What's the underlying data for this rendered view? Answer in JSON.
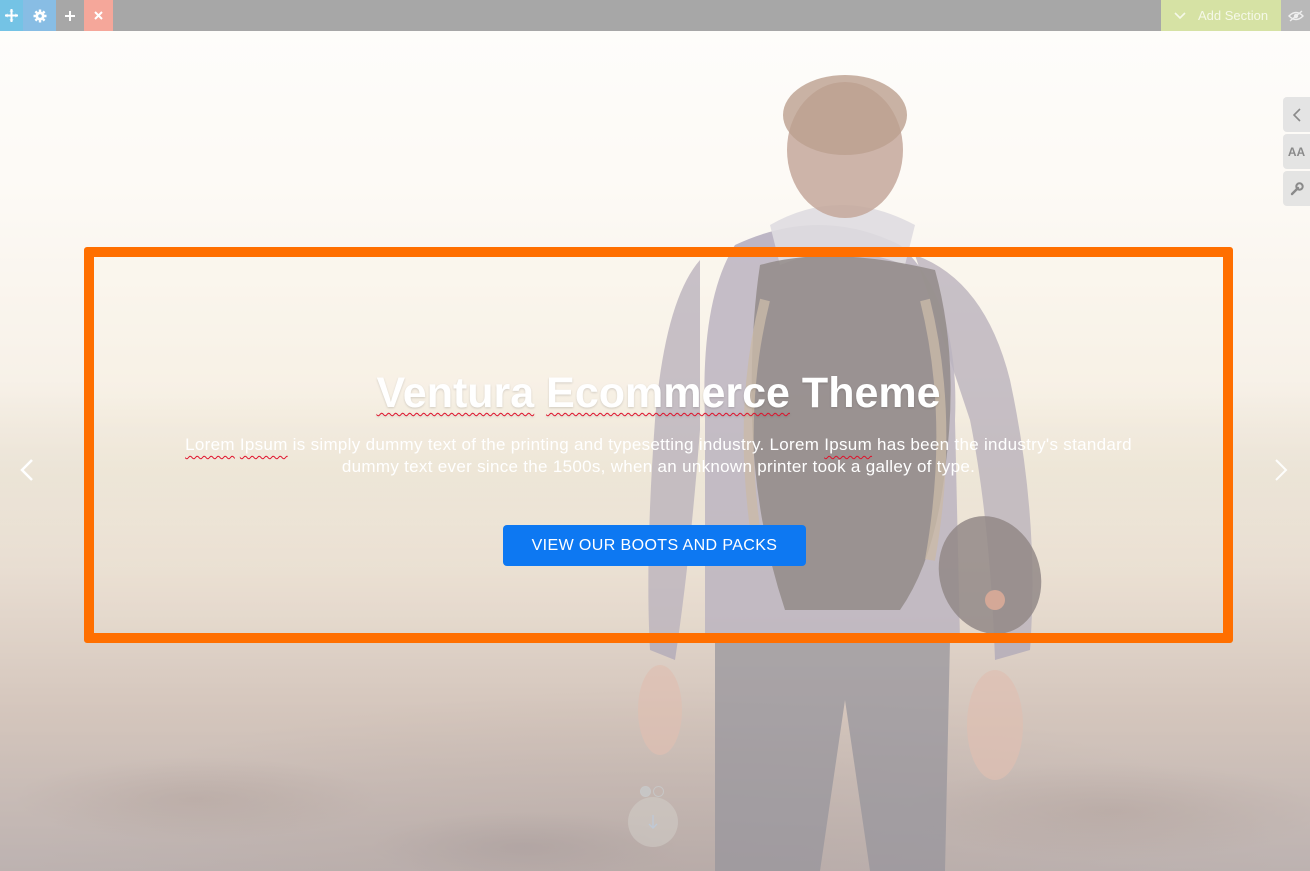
{
  "toolbar": {
    "move_icon": "move-icon",
    "settings_icon": "gear-icon",
    "add_icon": "plus-icon",
    "close_icon": "close-icon",
    "add_section_label": "Add Section",
    "add_section_icon": "chevron-down-icon",
    "visibility_icon": "eye-off-icon"
  },
  "side_tools": {
    "collapse_icon": "chevron-left-icon",
    "typography_label": "AA",
    "typography_icon": "font-size-icon",
    "tools_icon": "wrench-icon"
  },
  "hero": {
    "title_words": [
      "Ventura",
      "Ecommerce",
      "Theme"
    ],
    "description_line1_start": "Lorem",
    "description_line1_flag": "Ipsum",
    "description_line1_mid": " is simply dummy text of the printing and typesetting industry. Lorem ",
    "description_line1_flag2": "Ipsum",
    "description_line1_end": " has been the industry's standard",
    "description_line2": "dummy text ever since the 1500s, when an unknown printer took a galley of type.",
    "button_label": "VIEW OUR BOOTS AND PACKS"
  },
  "slider": {
    "prev_icon": "chevron-left-icon",
    "next_icon": "chevron-right-icon",
    "slide_count": 2,
    "active_slide": 1,
    "scroll_icon": "arrow-down-icon"
  },
  "colors": {
    "highlight_border": "#ff6f00",
    "button": "#0d78f2",
    "add_section_bg": "#d6e2a4",
    "topbar_bg": "#a7a7a7"
  }
}
